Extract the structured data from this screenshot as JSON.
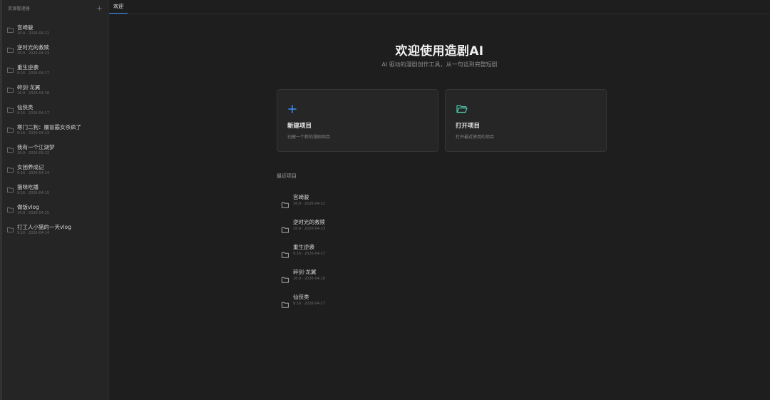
{
  "sidebar": {
    "title": "资源管理器",
    "add_icon": "plus-icon",
    "items": [
      {
        "name": "宫崎骏",
        "meta": "16:9 · 2026-04-21"
      },
      {
        "name": "逆时光的救赎",
        "meta": "16:9 · 2026-04-23"
      },
      {
        "name": "重生逆袭",
        "meta": "9:16 · 2026-04-17"
      },
      {
        "name": "碎剑·龙翼",
        "meta": "16:9 · 2026-04-18"
      },
      {
        "name": "仙侠类",
        "meta": "9:16 · 2026-04-17"
      },
      {
        "name": "寒门二狗：餍冒霸女杀疯了",
        "meta": "9:16 · 2026-04-13"
      },
      {
        "name": "我有一个江湖梦",
        "meta": "16:9 · 2026-09-22"
      },
      {
        "name": "女团养成记",
        "meta": "9:16 · 2026-04-14"
      },
      {
        "name": "猫咪吃播",
        "meta": "9:16 · 2026-04-15"
      },
      {
        "name": "做饭vlog",
        "meta": "16:9 · 2026-04-15"
      },
      {
        "name": "打工人小猫的一天vlog",
        "meta": "9:16 · 2026-04-14"
      }
    ]
  },
  "tabs": [
    {
      "label": "欢迎"
    }
  ],
  "welcome": {
    "title": "欢迎使用造剧AI",
    "subtitle": "AI 驱动的漫剧创作工具，从一句话到完整短剧"
  },
  "cards": {
    "new": {
      "title": "新建项目",
      "desc": "创建一个新的漫剧项目",
      "icon": "plus-icon",
      "color": "#3794ff"
    },
    "open": {
      "title": "打开项目",
      "desc": "打开最近使用的项目",
      "icon": "folder-open-icon",
      "color": "#4ec9b0"
    }
  },
  "recent": {
    "title": "最近项目",
    "items": [
      {
        "name": "宫崎骏",
        "meta": "16:9 · 2026-04-21"
      },
      {
        "name": "逆时光的救赎",
        "meta": "16:9 · 2026-04-23"
      },
      {
        "name": "重生逆袭",
        "meta": "9:16 · 2026-04-17"
      },
      {
        "name": "碎剑·龙翼",
        "meta": "16:9 · 2026-04-18"
      },
      {
        "name": "仙侠类",
        "meta": "9:16 · 2026-04-17"
      }
    ]
  }
}
